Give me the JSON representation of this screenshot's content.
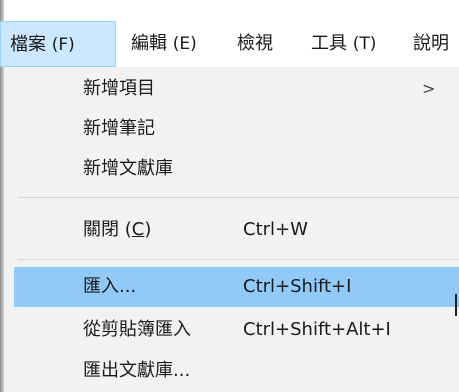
{
  "menubar": {
    "items": [
      {
        "label": "檔案",
        "mnemonic": "(F)"
      },
      {
        "label": "編輯",
        "mnemonic": "(E)"
      },
      {
        "label": "檢視",
        "mnemonic": ""
      },
      {
        "label": "工具",
        "mnemonic": "(T)"
      },
      {
        "label": "說明",
        "mnemonic": ""
      }
    ]
  },
  "file_menu": {
    "new_item": "新增項目",
    "new_item_arrow": ">",
    "new_note": "新增筆記",
    "new_library": "新增文獻庫",
    "close_label": "關閉",
    "close_mnemonic_open": "(",
    "close_mnemonic_key": "C",
    "close_mnemonic_close": ")",
    "close_shortcut": "Ctrl+W",
    "import_label": "匯入...",
    "import_shortcut": "Ctrl+Shift+I",
    "import_clipboard_label": "從剪貼簿匯入",
    "import_clipboard_shortcut": "Ctrl+Shift+Alt+I",
    "export_library_label": "匯出文獻庫..."
  },
  "colors": {
    "menubar_active_bg": "#cce8ff",
    "dropdown_bg": "#f2f2f2",
    "highlight_bg": "#91c9f7"
  }
}
